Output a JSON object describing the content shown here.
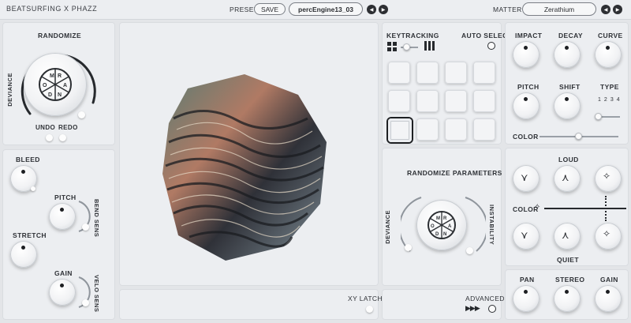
{
  "header": {
    "brand": "BEATSURFING X PHAZZ",
    "preset_label": "PRESET",
    "save_label": "SAVE",
    "preset_name": "percEngine13_03",
    "matter_label": "MATTER",
    "matter_name": "Zerathium",
    "prev_icon": "triangle-left",
    "next_icon": "triangle-right"
  },
  "randomize_panel": {
    "title": "RANDOMIZE",
    "deviance_label": "DEVIANCE",
    "undo_label": "UNDO",
    "redo_label": "REDO",
    "dice_letters": [
      "R",
      "A",
      "N",
      "D",
      "O",
      "M"
    ]
  },
  "left_panel": {
    "bleed_label": "BLEED",
    "pitch_label": "PITCH",
    "bend_sens_label": "BEND SENS",
    "stretch_label": "STRETCH",
    "gain_label": "GAIN",
    "velo_sens_label": "VELO SENS"
  },
  "center": {
    "xy_latch_label": "XY LATCH"
  },
  "pads_panel": {
    "keytracking_label": "KEYTRACKING",
    "auto_select_label": "AUTO SELECT",
    "pad_count": 12,
    "selected_pad": 8
  },
  "rand_params_panel": {
    "title": "RANDOMIZE PARAMETERS",
    "deviance_label": "DEVIANCE",
    "instability_label": "INSTABILITY",
    "dice_letters": [
      "R",
      "A",
      "N",
      "D",
      "O",
      "M"
    ]
  },
  "advanced": {
    "label": "ADVANCED",
    "icon": "triple-play-icon"
  },
  "right_top": {
    "impact_label": "IMPACT",
    "decay_label": "DECAY",
    "curve_label": "CURVE",
    "pitch_label": "PITCH",
    "shift_label": "SHIFT",
    "type_label": "TYPE",
    "type_options": [
      "1",
      "2",
      "3",
      "4"
    ],
    "color_label": "COLOR"
  },
  "right_mid": {
    "loud_label": "LOUD",
    "color_label": "COLOR",
    "quiet_label": "QUIET"
  },
  "right_bottom": {
    "pan_label": "PAN",
    "stereo_label": "STEREO",
    "gain_label": "GAIN"
  },
  "colors": {
    "background": "#e3e5e8",
    "panel": "#eceef1",
    "accent_dark": "#26292d"
  }
}
